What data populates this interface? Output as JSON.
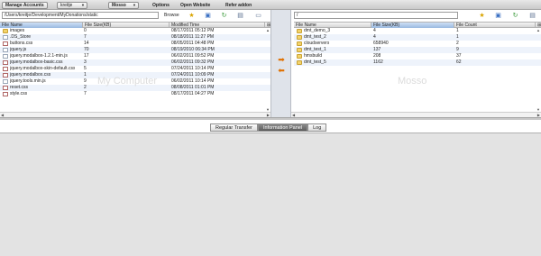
{
  "toolbar": {
    "manage_accounts": "Manage Accounts",
    "account": "kreitje",
    "provider": "Mosso",
    "menu": [
      "Options",
      "Open Website",
      "Refer addon"
    ]
  },
  "local": {
    "path": "/Users/kreitje/Development/MyDonations/static",
    "browse": "Browse",
    "watermark": "My Computer",
    "columns": [
      "File Name",
      "File Size(KB)",
      "Modified Time"
    ],
    "files": [
      {
        "name": "images",
        "size": "0",
        "modified": "08/17/2011 05:12 PM",
        "type": "folder"
      },
      {
        "name": ".DS_Store",
        "size": "7",
        "modified": "08/18/2011 11:27 PM",
        "type": "file"
      },
      {
        "name": "buttons.css",
        "size": "14",
        "modified": "08/05/2011 04:48 PM",
        "type": "css"
      },
      {
        "name": "jquery.js",
        "size": "70",
        "modified": "08/19/2010 06:34 PM",
        "type": "js"
      },
      {
        "name": "jquery.modalbox-1.2.1-min.js",
        "size": "17",
        "modified": "06/02/2011 09:52 PM",
        "type": "js"
      },
      {
        "name": "jquery.modalbox-basic.css",
        "size": "3",
        "modified": "06/02/2011 09:32 PM",
        "type": "css"
      },
      {
        "name": "jquery.modalbox-skin-default.css",
        "size": "5",
        "modified": "07/24/2011 10:14 PM",
        "type": "css"
      },
      {
        "name": "jquery.modalbox.css",
        "size": "1",
        "modified": "07/24/2011 10:09 PM",
        "type": "css"
      },
      {
        "name": "jquery.tools.min.js",
        "size": "9",
        "modified": "06/02/2011 10:14 PM",
        "type": "js"
      },
      {
        "name": "reset.css",
        "size": "2",
        "modified": "08/08/2011 01:01 PM",
        "type": "css"
      },
      {
        "name": "style.css",
        "size": "7",
        "modified": "08/17/2011 04:27 PM",
        "type": "css"
      }
    ]
  },
  "remote": {
    "path": "/",
    "watermark": "Mosso",
    "columns": [
      "File Name",
      "File Size(KB)",
      "File Count"
    ],
    "files": [
      {
        "name": "dmt_demo_3",
        "size": "4",
        "count": "1"
      },
      {
        "name": "dmt_test_2",
        "size": "4",
        "count": "1"
      },
      {
        "name": "cloudservers",
        "size": "658940",
        "count": "2"
      },
      {
        "name": "dmt_test_1",
        "size": "137",
        "count": "9"
      },
      {
        "name": "hmsbuild",
        "size": "208",
        "count": "37"
      },
      {
        "name": "dmt_test_5",
        "size": "1162",
        "count": "62"
      }
    ]
  },
  "tabs": [
    "Regular Transfer",
    "Information Panel",
    "Log"
  ],
  "active_tab": 1,
  "icons": {
    "toolbar": [
      "new-folder-icon",
      "upload-icon",
      "refresh-icon",
      "properties-icon"
    ],
    "transfer": [
      "upload-arrow-icon",
      "download-arrow-icon"
    ]
  },
  "colors": {
    "accent": "#e07000",
    "selected_header": "#9ab9e0",
    "folder": "#f3d36b"
  }
}
